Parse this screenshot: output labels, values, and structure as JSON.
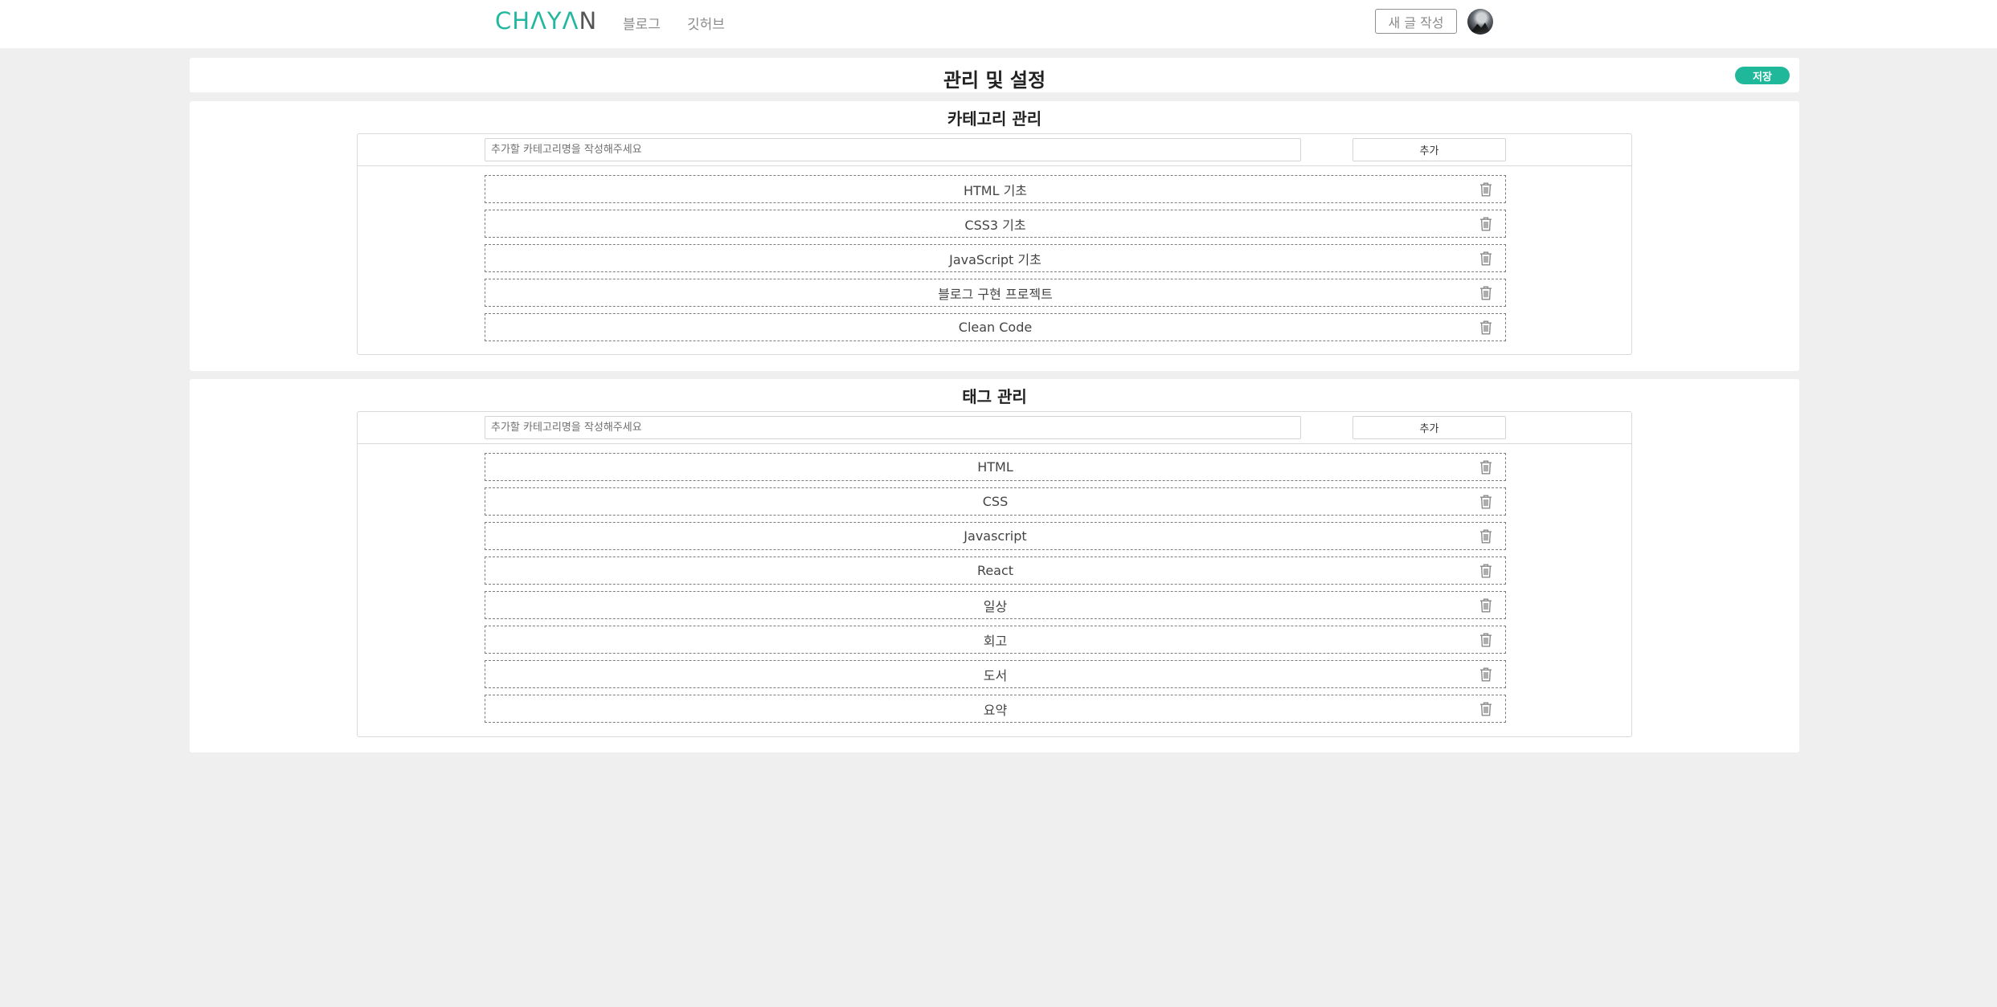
{
  "header": {
    "logo": {
      "part1": "CH",
      "part2": "Λ",
      "part3": "Y",
      "part4": "Λ",
      "part5": "N"
    },
    "nav": {
      "blog": "블로그",
      "github": "깃허브"
    },
    "new_post_label": "새 글 작성"
  },
  "title_bar": {
    "title": "관리 및 설정",
    "save_label": "저장"
  },
  "categories": {
    "title": "카테고리 관리",
    "placeholder": "추가할 카테고리명을 작성해주세요",
    "add_label": "추가",
    "items": [
      "HTML 기초",
      "CSS3 기초",
      "JavaScript 기초",
      "블로그 구현 프로젝트",
      "Clean Code"
    ]
  },
  "tags": {
    "title": "태그 관리",
    "placeholder": "추가할 카테고리명을 작성해주세요",
    "add_label": "추가",
    "items": [
      "HTML",
      "CSS",
      "Javascript",
      "React",
      "일상",
      "회고",
      "도서",
      "요약"
    ]
  },
  "colors": {
    "accent": "#1fb89a",
    "background": "#efefef"
  }
}
